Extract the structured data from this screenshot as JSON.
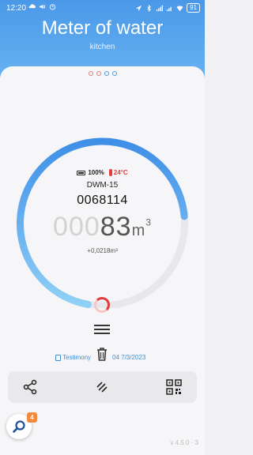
{
  "status_bar": {
    "time": "12:20",
    "battery": "91"
  },
  "header": {
    "title": "Meter of water",
    "subtitle": "kitchen"
  },
  "pager": {
    "pages": 4,
    "active_index": 3
  },
  "meter": {
    "battery": "100%",
    "temperature": "24°C",
    "device": "DWM-15",
    "serial": "0068114",
    "reading_faded": "000",
    "reading_bold": "83",
    "unit": "m",
    "unit_sup": "3",
    "delta": "+0,0218",
    "delta_unit": "m³",
    "gauge_fill_fraction": 0.75
  },
  "history": {
    "label": "Testimony",
    "date": "04 7/3/2023"
  },
  "actions": {
    "share": "share-icon",
    "menu": "stripes-icon",
    "qr": "qr-code-icon"
  },
  "search": {
    "badge": "4"
  },
  "footer": {
    "version": "v 4.5.0 · 3"
  },
  "colors": {
    "accent": "#4a98e8",
    "warning": "#e23b3b",
    "badge": "#f08a3c"
  }
}
